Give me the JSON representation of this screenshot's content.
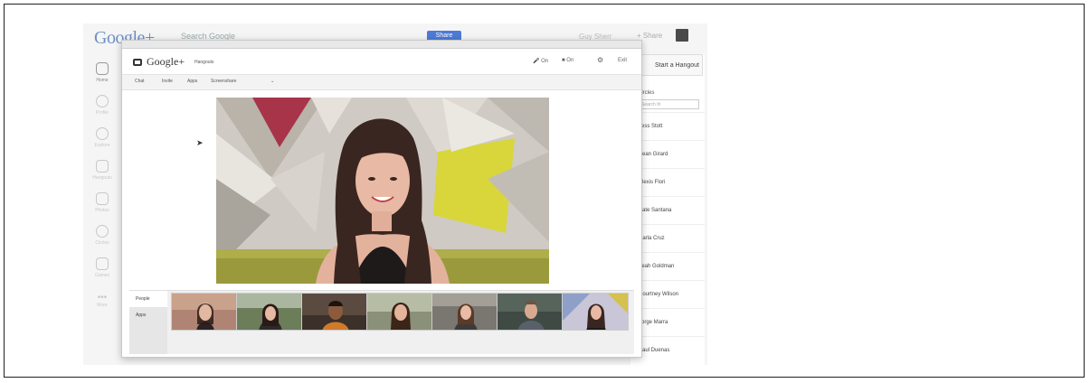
{
  "gplus": {
    "logo": "Google+",
    "search_placeholder": "Search Google",
    "share_label": "Share",
    "user_name": "Guy Sherr",
    "share_text": "+ Share",
    "nav": [
      {
        "label": "Home",
        "icon": "home-icon"
      },
      {
        "label": "Profile",
        "icon": "profile-icon"
      },
      {
        "label": "Explore",
        "icon": "explore-icon"
      },
      {
        "label": "Hangouts",
        "icon": "hangouts-icon"
      },
      {
        "label": "Photos",
        "icon": "photos-icon"
      },
      {
        "label": "Circles",
        "icon": "circles-icon"
      },
      {
        "label": "Games",
        "icon": "games-icon"
      },
      {
        "label": "More",
        "icon": "more-icon"
      }
    ],
    "start_hangout": "Start a Hangout",
    "circles_heading": "Circles",
    "circles_search": "Search th",
    "contacts": [
      "Jess Stott",
      "Sean Girard",
      "Alexis Flori",
      "Kate Santana",
      "Carla Cruz",
      "Leah Goldman",
      "Courtney Wilson",
      "Jorge Marra",
      "Paul Duenas"
    ]
  },
  "hangout": {
    "brand": "Google+",
    "brand_sub": "Hangouts",
    "controls": {
      "mic": "On",
      "camera": "On",
      "exit": "Exit"
    },
    "toolbar": [
      "Chat",
      "Invite",
      "Apps",
      "Screenshare"
    ],
    "filmstrip_tabs": [
      "People",
      "Apps"
    ]
  },
  "colors": {
    "accent_blue": "#4d7bd6",
    "logo_blue": "#6d8fc7"
  }
}
